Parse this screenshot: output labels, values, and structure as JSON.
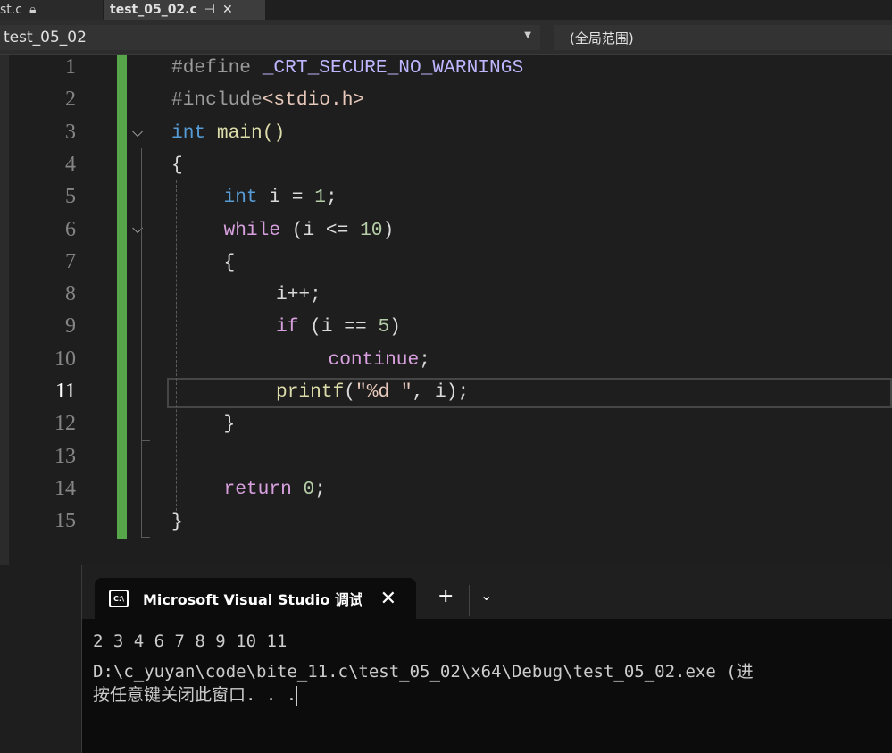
{
  "tabs": [
    {
      "label": "st.c",
      "icon": "lock-icon"
    },
    {
      "label": "test_05_02.c",
      "pin_icon": "pin-icon",
      "close_icon": "close-icon"
    }
  ],
  "navbar": {
    "project": "test_05_02",
    "scope": "(全局范围)"
  },
  "editor": {
    "active_line": 11,
    "line_numbers": [
      "1",
      "2",
      "3",
      "4",
      "5",
      "6",
      "7",
      "8",
      "9",
      "10",
      "11",
      "12",
      "13",
      "14",
      "15"
    ],
    "lines": [
      {
        "indent": 0,
        "tokens": [
          [
            "#define ",
            "#9b9b9b"
          ],
          [
            "_CRT_SECURE_NO_WARNINGS",
            "#beb7ff"
          ]
        ]
      },
      {
        "indent": 0,
        "tokens": [
          [
            "#include",
            "#9b9b9b"
          ],
          [
            "<stdio.h>",
            "#e8c9bb"
          ]
        ]
      },
      {
        "indent": 0,
        "tokens": [
          [
            "int",
            "#569cd6"
          ],
          [
            " main()",
            "#dcdcaa"
          ]
        ]
      },
      {
        "indent": 0,
        "tokens": [
          [
            "{",
            "#dadada"
          ]
        ]
      },
      {
        "indent": 1,
        "tokens": [
          [
            "int",
            "#569cd6"
          ],
          [
            " i = ",
            "#dadada"
          ],
          [
            "1",
            "#b5cea8"
          ],
          [
            ";",
            "#dadada"
          ]
        ]
      },
      {
        "indent": 1,
        "tokens": [
          [
            "while",
            "#d8a0df"
          ],
          [
            " (i <= ",
            "#dadada"
          ],
          [
            "10",
            "#b5cea8"
          ],
          [
            ")",
            "#dadada"
          ]
        ]
      },
      {
        "indent": 1,
        "tokens": [
          [
            "{",
            "#dadada"
          ]
        ]
      },
      {
        "indent": 2,
        "tokens": [
          [
            "i++;",
            "#dadada"
          ]
        ]
      },
      {
        "indent": 2,
        "tokens": [
          [
            "if",
            "#d8a0df"
          ],
          [
            " (i == ",
            "#dadada"
          ],
          [
            "5",
            "#b5cea8"
          ],
          [
            ")",
            "#dadada"
          ]
        ]
      },
      {
        "indent": 3,
        "tokens": [
          [
            "continue",
            "#d8a0df"
          ],
          [
            ";",
            "#dadada"
          ]
        ]
      },
      {
        "indent": 2,
        "tokens": [
          [
            "printf",
            "#dcdcaa"
          ],
          [
            "(",
            "#dadada"
          ],
          [
            "\"%d \"",
            "#e8c9bb"
          ],
          [
            ", i);",
            "#dadada"
          ]
        ]
      },
      {
        "indent": 1,
        "tokens": [
          [
            "}",
            "#dadada"
          ]
        ]
      },
      {
        "indent": 0,
        "tokens": []
      },
      {
        "indent": 1,
        "tokens": [
          [
            "return",
            "#d8a0df"
          ],
          [
            " ",
            "#dadada"
          ],
          [
            "0",
            "#b5cea8"
          ],
          [
            ";",
            "#dadada"
          ]
        ]
      },
      {
        "indent": 0,
        "tokens": [
          [
            "}",
            "#dadada"
          ]
        ]
      }
    ]
  },
  "terminal": {
    "tab_title": "Microsoft Visual Studio 调试控",
    "icon": "terminal-icon",
    "new_tab": "+",
    "output": [
      "2 3 4 6 7 8 9 10 11",
      "D:\\c_yuyan\\code\\bite_11.c\\test_05_02\\x64\\Debug\\test_05_02.exe (进",
      "按任意键关闭此窗口. . ."
    ]
  }
}
